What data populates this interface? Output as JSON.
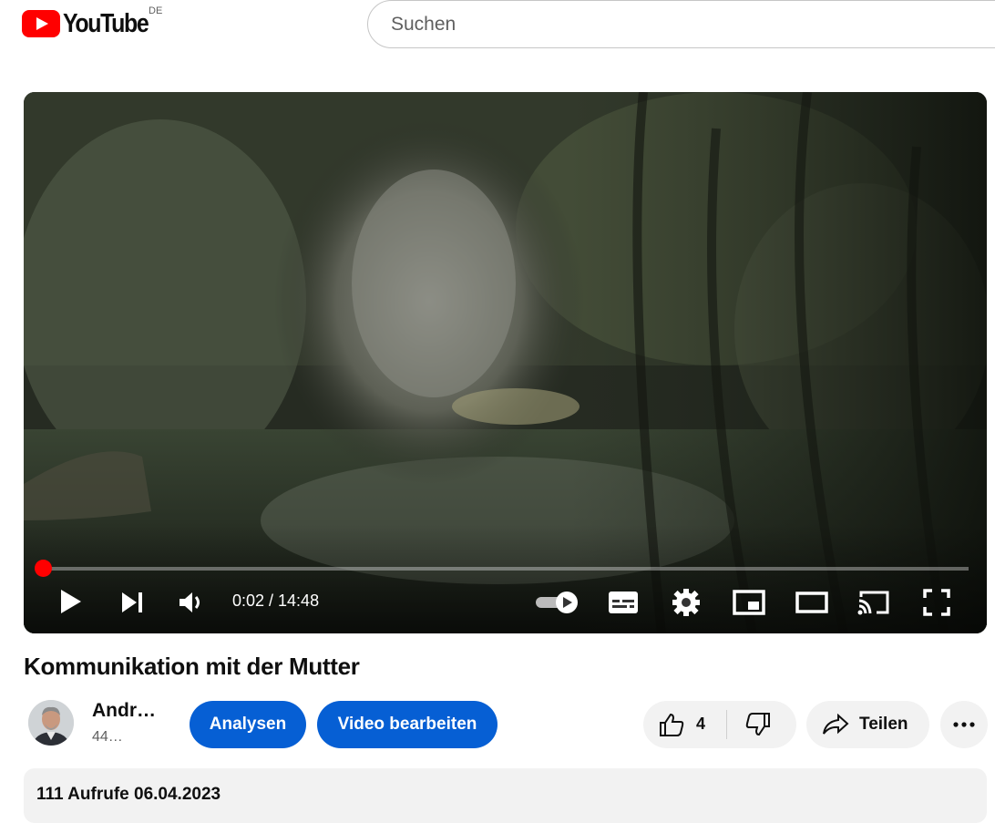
{
  "masthead": {
    "logo_text": "YouTube",
    "country_code": "DE",
    "search_placeholder": "Suchen",
    "search_value": ""
  },
  "player": {
    "time": "0:02 / 14:48",
    "progress_fraction": 0.0023,
    "autoplay": "on",
    "accent_color": "#ff0000"
  },
  "video": {
    "title": "Kommunikation mit der Mutter"
  },
  "channel": {
    "name": "Andr…",
    "subscribers": "44…"
  },
  "actions": {
    "analytics_label": "Analysen",
    "edit_label": "Video bearbeiten",
    "like_count": "4",
    "share_label": "Teilen",
    "button_color": "#065fd4"
  },
  "description": {
    "meta": "111 Aufrufe  06.04.2023"
  }
}
